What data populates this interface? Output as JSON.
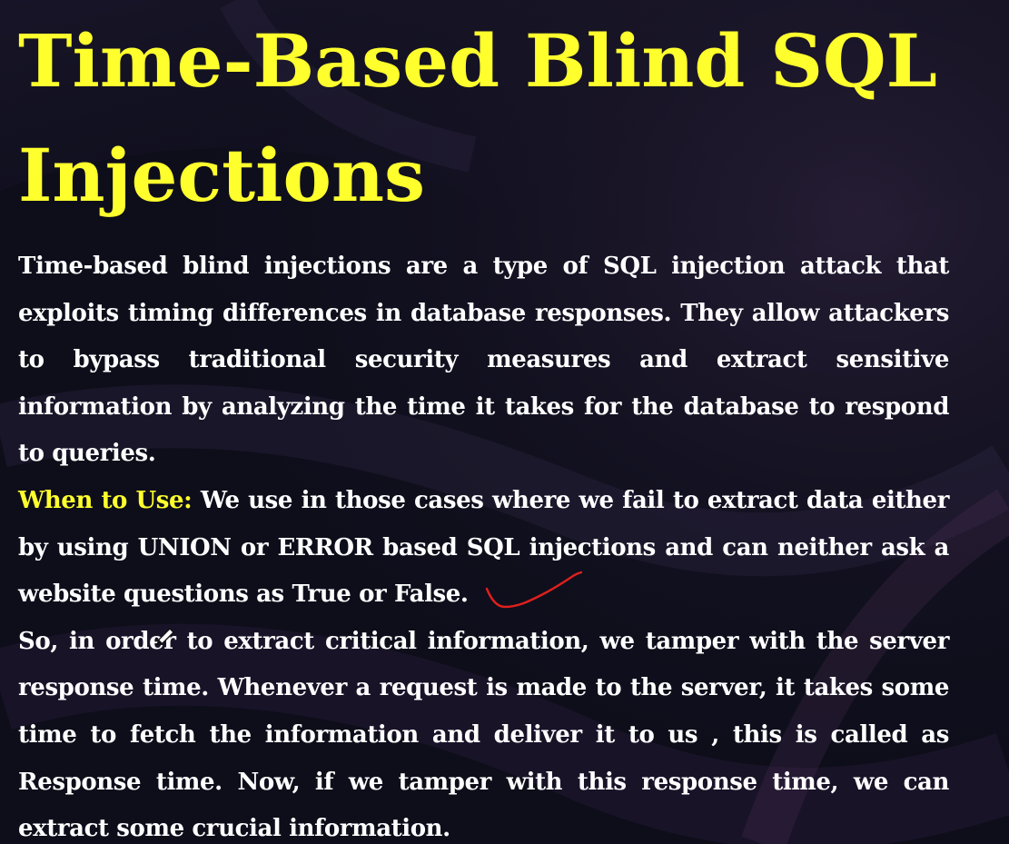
{
  "slide": {
    "title": "Time-Based Blind SQL Injections",
    "intro": "Time-based blind injections are a type of SQL injection attack that exploits timing differences in database responses. They allow attackers to bypass traditional security measures and extract sensitive information by analyzing the time it takes for the database to respond to queries.",
    "when_to_use_label": "When to Use:",
    "when_to_use_text": " We use in those cases where we fail to extract data either by using UNION or ERROR based SQL injections and can neither ask a website questions as True or False.",
    "explanation": "So, in order to extract critical information, we tamper with the server response time. Whenever a request is made to the server, it takes some time to fetch the information and deliver it to us , this is called as Response time. Now, if we tamper with this response time, we can extract some crucial information."
  },
  "colors": {
    "background": "#0f0f1d",
    "title": "#ffff2e",
    "highlight": "#ffff2e",
    "body_text": "#ffffff",
    "annotation": "#e0201c"
  },
  "icons": {
    "annotation": "red-check-scribble",
    "cursor": "pencil-cursor-icon"
  }
}
